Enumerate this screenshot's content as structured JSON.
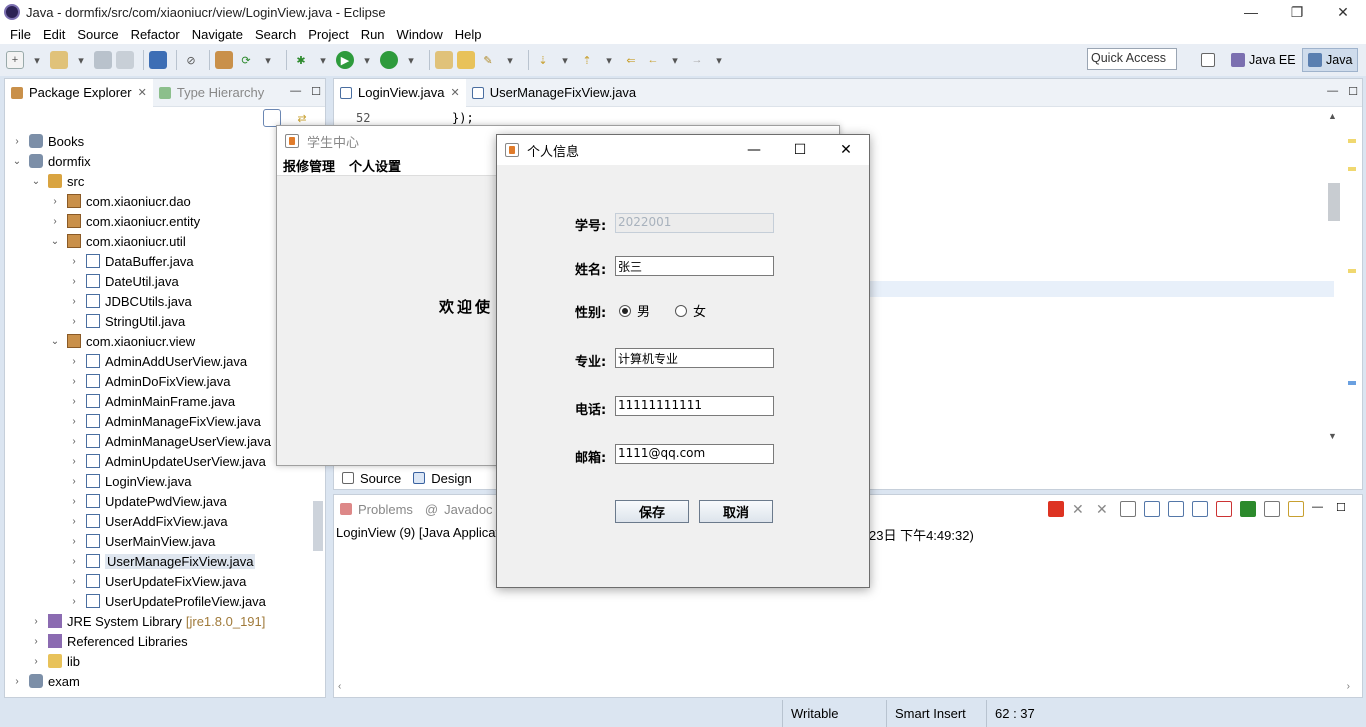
{
  "window": {
    "title": "Java - dormfix/src/com/xiaoniucr/view/LoginView.java - Eclipse",
    "controls": {
      "minimize": "—",
      "restore": "❐",
      "close": "✕"
    }
  },
  "menubar": {
    "items": [
      "File",
      "Edit",
      "Source",
      "Refactor",
      "Navigate",
      "Search",
      "Project",
      "Run",
      "Window",
      "Help"
    ]
  },
  "toolbar": {
    "quick_access": "Quick Access",
    "perspectives": [
      "Java EE",
      "Java"
    ],
    "active_perspective": "Java"
  },
  "package_explorer": {
    "tabs": [
      "Package Explorer",
      "Type Hierarchy"
    ],
    "tree": [
      {
        "label": "Books",
        "level": 0,
        "arrow": "›",
        "icon": "project-icon"
      },
      {
        "label": "dormfix",
        "level": 0,
        "arrow": "⌄",
        "icon": "project-icon"
      },
      {
        "label": "src",
        "level": 1,
        "arrow": "⌄",
        "icon": "source-folder-icon"
      },
      {
        "label": "com.xiaoniucr.dao",
        "level": 2,
        "arrow": "›",
        "icon": "package-icon"
      },
      {
        "label": "com.xiaoniucr.entity",
        "level": 2,
        "arrow": "›",
        "icon": "package-icon"
      },
      {
        "label": "com.xiaoniucr.util",
        "level": 2,
        "arrow": "⌄",
        "icon": "package-icon"
      },
      {
        "label": "DataBuffer.java",
        "level": 3,
        "arrow": "›",
        "icon": "java-file-icon"
      },
      {
        "label": "DateUtil.java",
        "level": 3,
        "arrow": "›",
        "icon": "java-file-icon"
      },
      {
        "label": "JDBCUtils.java",
        "level": 3,
        "arrow": "›",
        "icon": "java-file-icon"
      },
      {
        "label": "StringUtil.java",
        "level": 3,
        "arrow": "›",
        "icon": "java-file-icon"
      },
      {
        "label": "com.xiaoniucr.view",
        "level": 2,
        "arrow": "⌄",
        "icon": "package-icon"
      },
      {
        "label": "AdminAddUserView.java",
        "level": 3,
        "arrow": "›",
        "icon": "java-file-icon"
      },
      {
        "label": "AdminDoFixView.java",
        "level": 3,
        "arrow": "›",
        "icon": "java-file-icon"
      },
      {
        "label": "AdminMainFrame.java",
        "level": 3,
        "arrow": "›",
        "icon": "java-file-icon"
      },
      {
        "label": "AdminManageFixView.java",
        "level": 3,
        "arrow": "›",
        "icon": "java-file-icon"
      },
      {
        "label": "AdminManageUserView.java",
        "level": 3,
        "arrow": "›",
        "icon": "java-file-icon"
      },
      {
        "label": "AdminUpdateUserView.java",
        "level": 3,
        "arrow": "›",
        "icon": "java-file-icon"
      },
      {
        "label": "LoginView.java",
        "level": 3,
        "arrow": "›",
        "icon": "java-file-icon"
      },
      {
        "label": "UpdatePwdView.java",
        "level": 3,
        "arrow": "›",
        "icon": "java-file-icon"
      },
      {
        "label": "UserAddFixView.java",
        "level": 3,
        "arrow": "›",
        "icon": "java-file-icon"
      },
      {
        "label": "UserMainView.java",
        "level": 3,
        "arrow": "›",
        "icon": "java-file-icon"
      },
      {
        "label": "UserManageFixView.java",
        "level": 3,
        "arrow": "›",
        "icon": "java-file-icon",
        "selected": true
      },
      {
        "label": "UserUpdateFixView.java",
        "level": 3,
        "arrow": "›",
        "icon": "java-file-icon"
      },
      {
        "label": "UserUpdateProfileView.java",
        "level": 3,
        "arrow": "›",
        "icon": "java-file-icon"
      },
      {
        "label": "JRE System Library",
        "level": 1,
        "arrow": "›",
        "icon": "library-icon",
        "suffix": "[jre1.8.0_191]"
      },
      {
        "label": "Referenced Libraries",
        "level": 1,
        "arrow": "›",
        "icon": "library-icon"
      },
      {
        "label": "lib",
        "level": 1,
        "arrow": "›",
        "icon": "folder-icon"
      },
      {
        "label": "exam",
        "level": 0,
        "arrow": "›",
        "icon": "project-icon"
      }
    ]
  },
  "editor": {
    "tabs": [
      "LoginView.java",
      "UserManageFixView.java"
    ],
    "line_number": "52",
    "line_code": "});",
    "bottom_tabs": [
      "Source",
      "Design"
    ]
  },
  "console": {
    "tabs": [
      "Problems",
      "Javadoc"
    ],
    "line_start": "LoginView (9) [Java Applicat",
    "line_end": "月23日 下午4:49:32)"
  },
  "statusbar": {
    "writable": "Writable",
    "insert_mode": "Smart Insert",
    "position": "62 : 37"
  },
  "student_frame": {
    "title": "学生中心",
    "menu": [
      "报修管理",
      "个人设置"
    ],
    "welcome": "欢迎使"
  },
  "info_dialog": {
    "title": "个人信息",
    "student_no_label": "学号:",
    "student_no": "2022001",
    "name_label": "姓名:",
    "name": "张三",
    "gender_label": "性别:",
    "gender_male": "男",
    "gender_female": "女",
    "major_label": "专业:",
    "major": "计算机专业",
    "phone_label": "电话:",
    "phone": "11111111111",
    "email_label": "邮箱:",
    "email": "1111@qq.com",
    "save_label": "保存",
    "cancel_label": "取消"
  }
}
